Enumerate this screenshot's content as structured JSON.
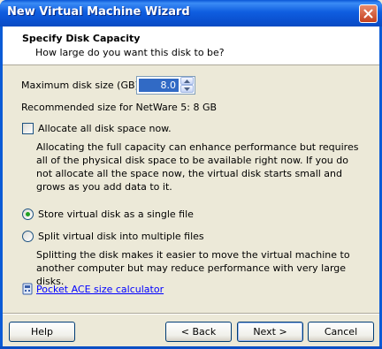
{
  "window": {
    "title": "New Virtual Machine Wizard"
  },
  "header": {
    "title": "Specify Disk Capacity",
    "subtitle": "How large do you want this disk to be?"
  },
  "disk_size": {
    "label": "Maximum disk size (GB):",
    "value": "8.0",
    "recommended": "Recommended size for NetWare 5: 8 GB"
  },
  "allocate": {
    "label": "Allocate all disk space now.",
    "checked": false,
    "description": "Allocating the full capacity can enhance performance but requires all of the physical disk space to be available right now. If you do not allocate all the space now, the virtual disk starts small and grows as you add data to it."
  },
  "file_options": {
    "single_label": "Store virtual disk as a single file",
    "single_selected": true,
    "split_label": "Split virtual disk into multiple files",
    "split_selected": false,
    "split_description": "Splitting the disk makes it easier to move the virtual machine to another computer but may reduce performance with very large disks."
  },
  "calculator_link": "Pocket ACE size calculator",
  "buttons": {
    "help": "Help",
    "back": "< Back",
    "next": "Next >",
    "cancel": "Cancel"
  },
  "colors": {
    "title_bar": "#0a50cf",
    "selection": "#316ac5",
    "radio_dot": "#21a121",
    "close_button": "#c4411f"
  }
}
